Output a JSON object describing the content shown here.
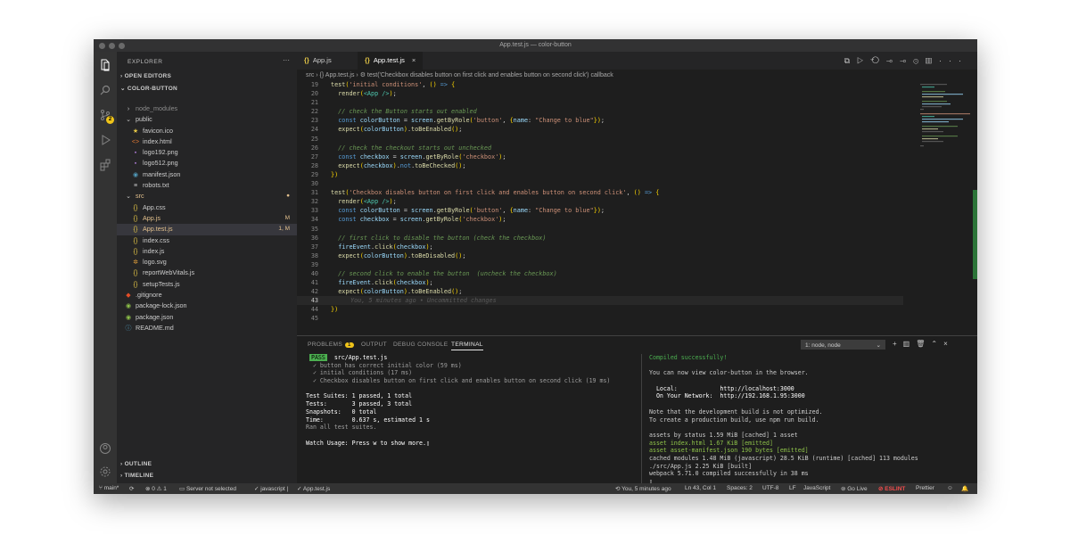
{
  "window": {
    "title": "App.test.js — color-button"
  },
  "sidebar": {
    "title": "EXPLORER",
    "open_editors": "OPEN EDITORS",
    "project": "COLOR-BUTTON",
    "outline": "OUTLINE",
    "timeline": "TIMELINE",
    "git_badge": "2",
    "items": [
      {
        "label": "node_modules",
        "icon": "›",
        "indent": 8,
        "color": "#8b8b8b",
        "status": ""
      },
      {
        "label": "public",
        "icon": "⌄",
        "indent": 8,
        "color": "#cccccc",
        "status": ""
      },
      {
        "label": "favicon.ico",
        "icon": "★",
        "indent": 16,
        "color": "#cccccc",
        "status": "",
        "icon_color": "#e6c847"
      },
      {
        "label": "index.html",
        "icon": "<>",
        "indent": 16,
        "color": "#cccccc",
        "status": "",
        "icon_color": "#e37933"
      },
      {
        "label": "logo192.png",
        "icon": "▪",
        "indent": 16,
        "color": "#cccccc",
        "status": "",
        "icon_color": "#a074c4"
      },
      {
        "label": "logo512.png",
        "icon": "▪",
        "indent": 16,
        "color": "#cccccc",
        "status": "",
        "icon_color": "#a074c4"
      },
      {
        "label": "manifest.json",
        "icon": "◉",
        "indent": 16,
        "color": "#cccccc",
        "status": "",
        "icon_color": "#519aba"
      },
      {
        "label": "robots.txt",
        "icon": "≡",
        "indent": 16,
        "color": "#cccccc",
        "status": "",
        "icon_color": "#cccccc"
      },
      {
        "label": "src",
        "icon": "⌄",
        "indent": 8,
        "color": "#e2c08d",
        "status": "●",
        "status_color": "#e2c08d"
      },
      {
        "label": "App.css",
        "icon": "{}",
        "indent": 16,
        "color": "#cccccc",
        "status": "",
        "icon_color": "#e6c847"
      },
      {
        "label": "App.js",
        "icon": "{}",
        "indent": 16,
        "color": "#e2c08d",
        "status": "M",
        "status_color": "#e2c08d",
        "icon_color": "#e6c847"
      },
      {
        "label": "App.test.js",
        "icon": "{}",
        "indent": 16,
        "color": "#e2c08d",
        "status": "1, M",
        "status_color": "#e2c08d",
        "icon_color": "#e6c847",
        "active": true
      },
      {
        "label": "index.css",
        "icon": "{}",
        "indent": 16,
        "color": "#cccccc",
        "status": "",
        "icon_color": "#e6c847"
      },
      {
        "label": "index.js",
        "icon": "{}",
        "indent": 16,
        "color": "#cccccc",
        "status": "",
        "icon_color": "#e6c847"
      },
      {
        "label": "logo.svg",
        "icon": "✲",
        "indent": 16,
        "color": "#cccccc",
        "status": "",
        "icon_color": "#e6a23c"
      },
      {
        "label": "reportWebVitals.js",
        "icon": "{}",
        "indent": 16,
        "color": "#cccccc",
        "status": "",
        "icon_color": "#e6c847"
      },
      {
        "label": "setupTests.js",
        "icon": "{}",
        "indent": 16,
        "color": "#cccccc",
        "status": "",
        "icon_color": "#e6c847"
      },
      {
        "label": ".gitignore",
        "icon": "◆",
        "indent": 8,
        "color": "#cccccc",
        "status": "",
        "icon_color": "#e44d26"
      },
      {
        "label": "package-lock.json",
        "icon": "◉",
        "indent": 8,
        "color": "#cccccc",
        "status": "",
        "icon_color": "#8dc149"
      },
      {
        "label": "package.json",
        "icon": "◉",
        "indent": 8,
        "color": "#cccccc",
        "status": "",
        "icon_color": "#8dc149"
      },
      {
        "label": "README.md",
        "icon": "ⓘ",
        "indent": 8,
        "color": "#cccccc",
        "status": "",
        "icon_color": "#519aba"
      }
    ]
  },
  "tabs": [
    {
      "label": "App.js",
      "icon": "{}",
      "active": false
    },
    {
      "label": "App.test.js",
      "icon": "{}",
      "active": true
    }
  ],
  "breadcrumb": "src  ›  {}  App.test.js  ›  ⚙  test('Checkbox disables button on first click and enables button on second click') callback",
  "code": [
    {
      "n": "19",
      "t": "test('initial conditions', () => {"
    },
    {
      "n": "20",
      "t": "  render(<App />);"
    },
    {
      "n": "21",
      "t": ""
    },
    {
      "n": "22",
      "t": "  // check the Button starts out enabled"
    },
    {
      "n": "23",
      "t": "  const colorButton = screen.getByRole('button', {name: \"Change to blue\"});"
    },
    {
      "n": "24",
      "t": "  expect(colorButton).toBeEnabled();"
    },
    {
      "n": "25",
      "t": ""
    },
    {
      "n": "26",
      "t": "  // check the checkout starts out unchecked"
    },
    {
      "n": "27",
      "t": "  const checkbox = screen.getByRole('checkbox');"
    },
    {
      "n": "28",
      "t": "  expect(checkbox).not.toBeChecked();"
    },
    {
      "n": "29",
      "t": "})"
    },
    {
      "n": "30",
      "t": ""
    },
    {
      "n": "31",
      "t": "test('Checkbox disables button on first click and enables button on second click', () => {"
    },
    {
      "n": "32",
      "t": "  render(<App />);"
    },
    {
      "n": "33",
      "t": "  const colorButton = screen.getByRole('button', {name: \"Change to blue\"});"
    },
    {
      "n": "34",
      "t": "  const checkbox = screen.getByRole('checkbox');"
    },
    {
      "n": "35",
      "t": ""
    },
    {
      "n": "36",
      "t": "  // first click to disable the button (check the checkbox)"
    },
    {
      "n": "37",
      "t": "  fireEvent.click(checkbox);"
    },
    {
      "n": "38",
      "t": "  expect(colorButton).toBeDisabled();"
    },
    {
      "n": "39",
      "t": ""
    },
    {
      "n": "40",
      "t": "  // second click to enable the button  (uncheck the checkbox)"
    },
    {
      "n": "41",
      "t": "  fireEvent.click(checkbox);"
    },
    {
      "n": "42",
      "t": "  expect(colorButton).toBeEnabled();"
    },
    {
      "n": "43",
      "t": "",
      "blame": "You, 5 minutes ago • Uncommitted changes",
      "current": true
    },
    {
      "n": "44",
      "t": "})"
    },
    {
      "n": "45",
      "t": ""
    }
  ],
  "panel": {
    "tabs": [
      "PROBLEMS",
      "OUTPUT",
      "DEBUG CONSOLE",
      "TERMINAL"
    ],
    "problems_count": "1",
    "terminal_select": "1: node, node",
    "left": [
      {
        "t": " PASS  src/App.test.js",
        "c": "#ffffff",
        "pass": true
      },
      {
        "t": "  ✓ button has correct initial color (59 ms)",
        "c": "#9e9e9e"
      },
      {
        "t": "  ✓ initial conditions (17 ms)",
        "c": "#9e9e9e"
      },
      {
        "t": "  ✓ Checkbox disables button on first click and enables button on second click (19 ms)",
        "c": "#9e9e9e"
      },
      {
        "t": "",
        "c": "#cccccc"
      },
      {
        "t": "Test Suites: 1 passed, 1 total",
        "c": "#ffffff"
      },
      {
        "t": "Tests:       3 passed, 3 total",
        "c": "#ffffff"
      },
      {
        "t": "Snapshots:   0 total",
        "c": "#ffffff"
      },
      {
        "t": "Time:        0.637 s, estimated 1 s",
        "c": "#ffffff"
      },
      {
        "t": "Ran all test suites.",
        "c": "#9e9e9e"
      },
      {
        "t": "",
        "c": "#cccccc"
      },
      {
        "t": "Watch Usage: Press w to show more.▯",
        "c": "#ffffff"
      }
    ],
    "right": [
      {
        "t": "Compiled successfully!",
        "c": "#4caf50"
      },
      {
        "t": "",
        "c": "#cccccc"
      },
      {
        "t": "You can now view color-button in the browser.",
        "c": "#cccccc"
      },
      {
        "t": "",
        "c": "#cccccc"
      },
      {
        "t": "  Local:            http://localhost:3000",
        "c": "#ffffff"
      },
      {
        "t": "  On Your Network:  http://192.168.1.95:3000",
        "c": "#ffffff"
      },
      {
        "t": "",
        "c": "#cccccc"
      },
      {
        "t": "Note that the development build is not optimized.",
        "c": "#cccccc"
      },
      {
        "t": "To create a production build, use npm run build.",
        "c": "#cccccc"
      },
      {
        "t": "",
        "c": "#cccccc"
      },
      {
        "t": "assets by status 1.59 MiB [cached] 1 asset",
        "c": "#cccccc"
      },
      {
        "t": "asset index.html 1.67 KiB [emitted]",
        "c": "#8dc149"
      },
      {
        "t": "asset asset-manifest.json 190 bytes [emitted]",
        "c": "#8dc149"
      },
      {
        "t": "cached modules 1.48 MiB (javascript) 28.5 KiB (runtime) [cached] 113 modules",
        "c": "#cccccc"
      },
      {
        "t": "./src/App.js 2.25 KiB [built]",
        "c": "#cccccc"
      },
      {
        "t": "webpack 5.71.0 compiled successfully in 38 ms",
        "c": "#cccccc"
      },
      {
        "t": "▯",
        "c": "#cccccc"
      }
    ]
  },
  "statusbar": {
    "branch": "main*",
    "sync": "⟳",
    "errors": "⊗ 0 ⚠ 1",
    "server": "Server not selected",
    "lang_check": "✓ javascript |",
    "file_check": "✓ App.test.js",
    "blame": "You, 5 minutes ago",
    "position": "Ln 43, Col 1",
    "spaces": "Spaces: 2",
    "encoding": "UTF-8",
    "eol": "LF",
    "language": "JavaScript",
    "golive": "⊚ Go Live",
    "eslint": "⊘ ESLINT",
    "prettier": "Prettier"
  }
}
